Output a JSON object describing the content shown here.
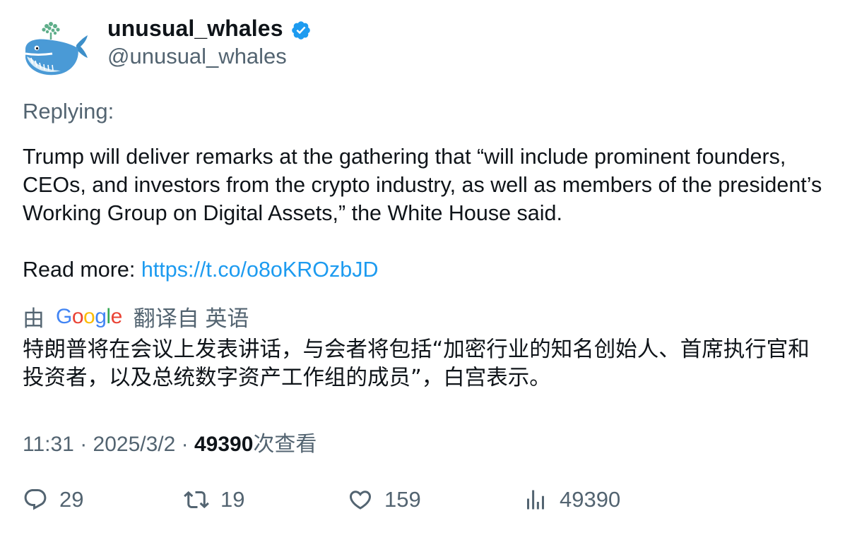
{
  "author": {
    "display_name": "unusual_whales",
    "handle": "@unusual_whales",
    "verified": true,
    "avatar_icon": "whale-avatar-icon",
    "verified_color": "#1d9bf0"
  },
  "replying_label": "Replying:",
  "tweet": {
    "text": "Trump will deliver remarks at the gathering that “will include prominent founders, CEOs, and investors from the crypto industry, as well as members of the president’s Working Group on Digital Assets,” the White House said.",
    "read_more_label": "Read more: ",
    "link": "https://t.co/o8oKROzbJD",
    "link_color": "#1d9bf0"
  },
  "translation": {
    "by_label": "由",
    "provider": "Google",
    "from_label": "翻译自 英语",
    "text": "特朗普将在会议上发表讲话，与会者将包括“加密行业的知名创始人、首席执行官和投资者，以及总统数字资产工作组的成员”，白宫表示。"
  },
  "meta": {
    "time": "11:31",
    "separator": " · ",
    "date": "2025/3/2",
    "views_count": "49390",
    "views_label": "次查看"
  },
  "actions": {
    "reply": {
      "icon": "reply-icon",
      "count": "29"
    },
    "retweet": {
      "icon": "retweet-icon",
      "count": "19"
    },
    "like": {
      "icon": "heart-icon",
      "count": "159"
    },
    "views": {
      "icon": "views-chart-icon",
      "count": "49390"
    }
  }
}
